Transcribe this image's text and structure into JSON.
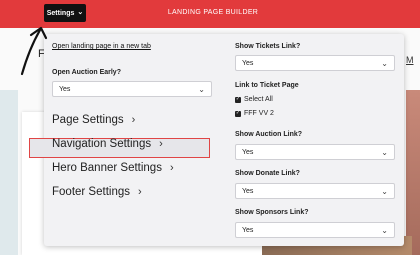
{
  "topbar": {
    "settings_label": "Settings",
    "app_title": "LANDING PAGE BUILDER"
  },
  "background": {
    "logo_fragment": "F",
    "nav_fragment": "M"
  },
  "panel": {
    "open_link": "Open landing page in a new tab",
    "auction_early": {
      "label": "Open Auction Early?",
      "value": "Yes"
    },
    "sections": [
      {
        "label": "Page Settings"
      },
      {
        "label": "Navigation Settings"
      },
      {
        "label": "Hero Banner Settings"
      },
      {
        "label": "Footer Settings"
      }
    ],
    "show_tickets": {
      "label": "Show Tickets Link?",
      "value": "Yes"
    },
    "link_to_ticket": {
      "label": "Link to Ticket Page",
      "options": [
        {
          "label": "Select All",
          "checked": true
        },
        {
          "label": "FFF VV 2",
          "checked": true
        }
      ]
    },
    "show_auction": {
      "label": "Show Auction Link?",
      "value": "Yes"
    },
    "show_donate": {
      "label": "Show Donate Link?",
      "value": "Yes"
    },
    "show_sponsors": {
      "label": "Show Sponsors Link?",
      "value": "Yes"
    }
  },
  "colors": {
    "topbar": "#e23a3c",
    "highlight_border": "#e04545",
    "panel_bg": "#f2f2f4"
  }
}
